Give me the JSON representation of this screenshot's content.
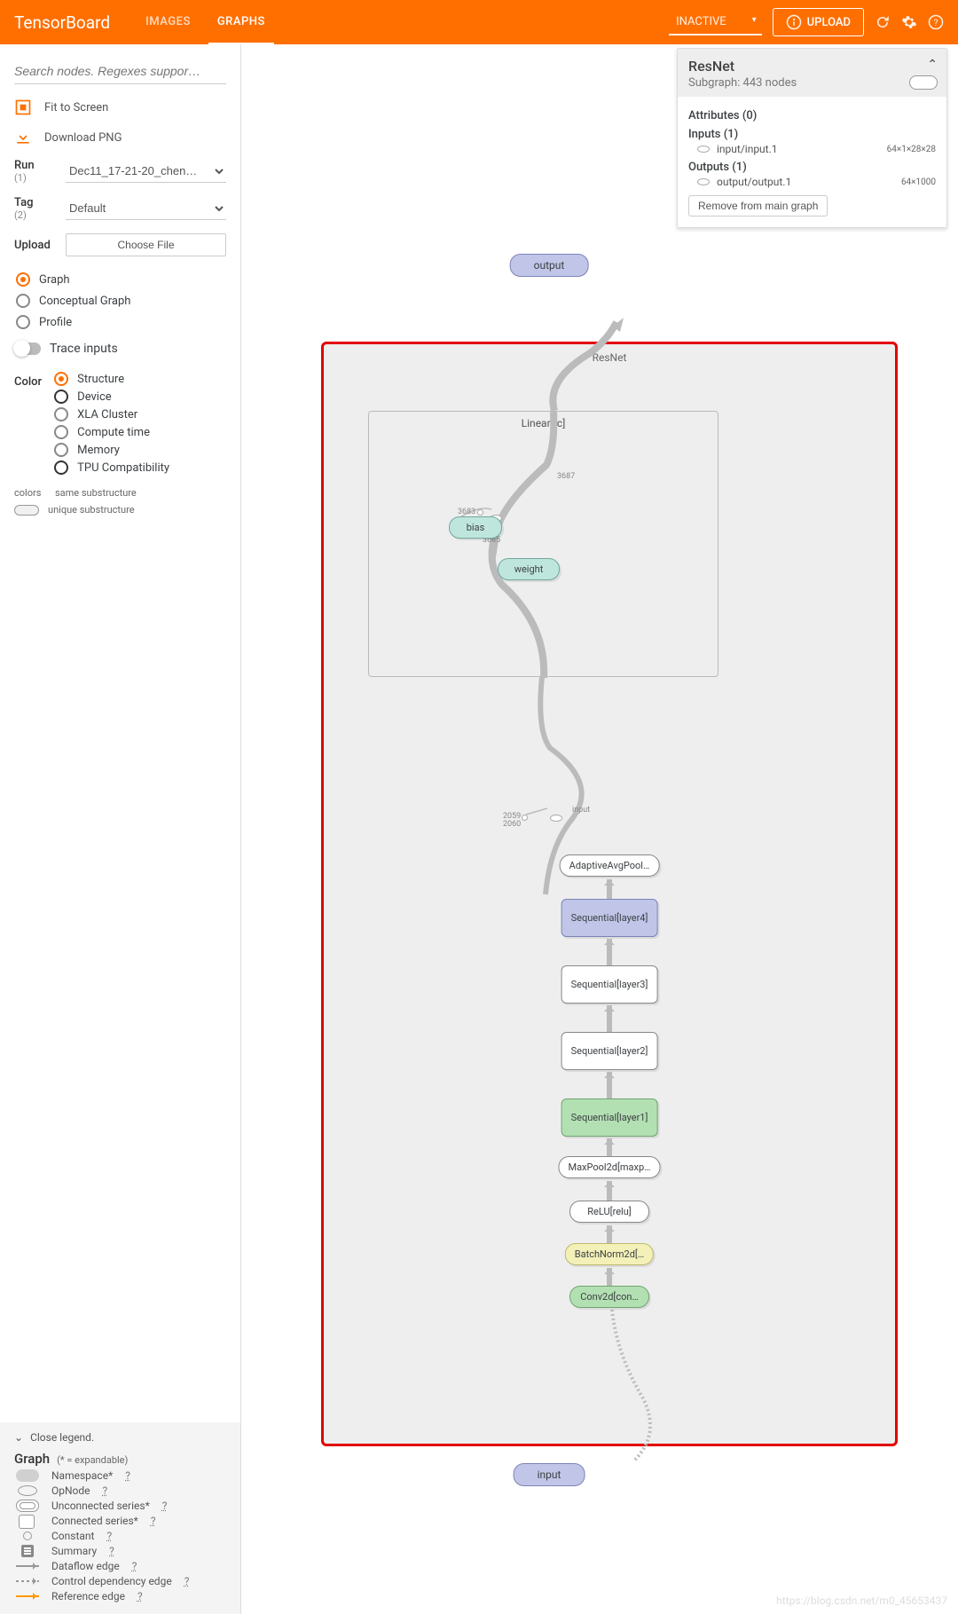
{
  "header": {
    "logo": "TensorBoard",
    "tabs": {
      "images": "IMAGES",
      "graphs": "GRAPHS"
    },
    "inactive": "INACTIVE",
    "upload": "UPLOAD"
  },
  "sidebar": {
    "search_placeholder": "Search nodes. Regexes suppor…",
    "fit": "Fit to Screen",
    "download": "Download PNG",
    "run_label": "Run",
    "run_count": "(1)",
    "run_value": "Dec11_17-21-20_chen…",
    "tag_label": "Tag",
    "tag_count": "(2)",
    "tag_value": "Default",
    "upload_label": "Upload",
    "choose_file": "Choose File",
    "view": {
      "graph": "Graph",
      "conceptual": "Conceptual Graph",
      "profile": "Profile"
    },
    "trace": "Trace inputs",
    "color_label": "Color",
    "color": {
      "structure": "Structure",
      "device": "Device",
      "xla": "XLA Cluster",
      "compute": "Compute time",
      "memory": "Memory",
      "tpu": "TPU Compatibility"
    },
    "colors_label": "colors",
    "same": "same substructure",
    "unique": "unique substructure"
  },
  "legend": {
    "close": "Close legend.",
    "title": "Graph",
    "sub": "(* = expandable)",
    "items": {
      "namespace": "Namespace*",
      "opnode": "OpNode",
      "unconnected": "Unconnected series*",
      "connected": "Connected series*",
      "constant": "Constant",
      "summary": "Summary",
      "dataflow": "Dataflow edge",
      "control": "Control dependency edge",
      "reference": "Reference edge"
    }
  },
  "info": {
    "title": "ResNet",
    "sub": "Subgraph: 443 nodes",
    "attrs": "Attributes (0)",
    "inputs_h": "Inputs (1)",
    "input_item": "input/input.1",
    "input_dim": "64×1×28×28",
    "outputs_h": "Outputs (1)",
    "output_item": "output/output.1",
    "output_dim": "64×1000",
    "remove": "Remove from main graph"
  },
  "graph": {
    "output": "output",
    "input": "input",
    "resnet": "ResNet",
    "linear": "Linear[fc]",
    "bias": "bias",
    "weight": "weight",
    "num_3687": "3687",
    "num_3683": "3683",
    "num_3685": "3685",
    "input_lbl": "input",
    "num_2059": "2059",
    "num_2060": "2060",
    "avgpool": "AdaptiveAvgPool…",
    "layer4": "Sequential[layer4]",
    "layer3": "Sequential[layer3]",
    "layer2": "Sequential[layer2]",
    "layer1": "Sequential[layer1]",
    "maxpool": "MaxPool2d[maxp…",
    "relu": "ReLU[relu]",
    "bn": "BatchNorm2d[…",
    "conv": "Conv2d[con…"
  },
  "watermark": "https://blog.csdn.net/m0_45653437"
}
